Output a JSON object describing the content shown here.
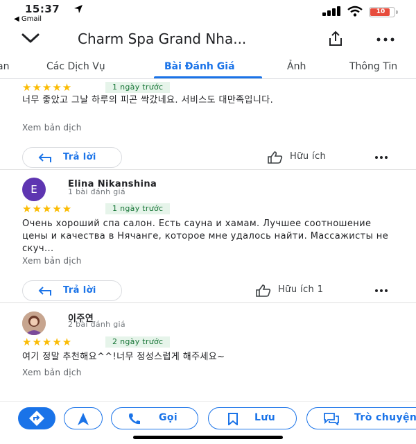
{
  "status_bar": {
    "time": "15:37",
    "back_app": "◀ Gmail",
    "battery": "10"
  },
  "header": {
    "title": "Charm Spa Grand Nha..."
  },
  "tabs": [
    "an",
    "Các Dịch Vụ",
    "Bài Đánh Giá",
    "Ảnh",
    "Thông Tin"
  ],
  "active_tab": "Bài Đánh Giá",
  "reviews": [
    {
      "stars": "★★★★★",
      "date": "1 ngày trước",
      "text": "너무 좋았고  그날 하루의 피곤 싹갔네요. 서비스도 대만족입니다.",
      "translate": "Xem bản dịch",
      "reply": "Trả lời",
      "helpful": "Hữu ích"
    },
    {
      "avatar_letter": "E",
      "name": "Elina Nikanshina",
      "count": "1 bài đánh giá",
      "stars": "★★★★★",
      "date": "1 ngày trước",
      "text": "Очень хороший спа салон. Есть сауна и хамам. Лучшее соотношение цены и качества в Нячанге, которое мне удалось найти. Массажисты не скуч...",
      "translate": "Xem bản dịch",
      "reply": "Trả lời",
      "helpful": "Hữu ích 1"
    },
    {
      "name": "이주연",
      "count": "2 bài đánh giá",
      "stars": "★★★★★",
      "date": "2 ngày trước",
      "text": "여기 정말 추천해요^^!너무 정성스럽게 해주세요~",
      "translate": "Xem bản dịch"
    }
  ],
  "bottom_bar": {
    "call": "Gọi",
    "save": "Lưu",
    "share": "Trò chuyện"
  },
  "colors": {
    "accent": "#1a73e8",
    "star": "#fbbc04",
    "date_bg": "#e6f4ea",
    "date_text": "#137333",
    "avatar": "#5e35b1"
  }
}
